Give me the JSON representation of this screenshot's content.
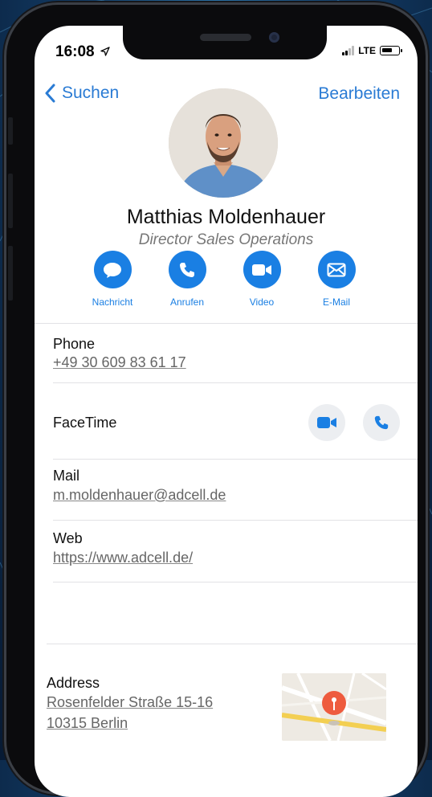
{
  "status": {
    "time": "16:08",
    "network": "LTE"
  },
  "nav": {
    "back_label": "Suchen",
    "edit_label": "Bearbeiten"
  },
  "contact": {
    "name": "Matthias Moldenhauer",
    "title": "Director Sales Operations"
  },
  "actions": [
    {
      "label": "Nachricht",
      "icon": "message-icon"
    },
    {
      "label": "Anrufen",
      "icon": "phone-icon"
    },
    {
      "label": "Video",
      "icon": "video-icon"
    },
    {
      "label": "E-Mail",
      "icon": "mail-icon"
    }
  ],
  "fields": {
    "phone": {
      "label": "Phone",
      "value": "+49 30 609 83 61 17"
    },
    "facetime": {
      "label": "FaceTime"
    },
    "mail": {
      "label": "Mail",
      "value": "m.moldenhauer@adcell.de"
    },
    "web": {
      "label": "Web",
      "value": "https://www.adcell.de/"
    },
    "address": {
      "label": "Address",
      "line1": "Rosenfelder Straße 15-16",
      "line2": "10315 Berlin"
    }
  },
  "colors": {
    "accent": "#1a7fe3",
    "link": "#2a7bd4",
    "map_pin": "#ee5b3e"
  }
}
